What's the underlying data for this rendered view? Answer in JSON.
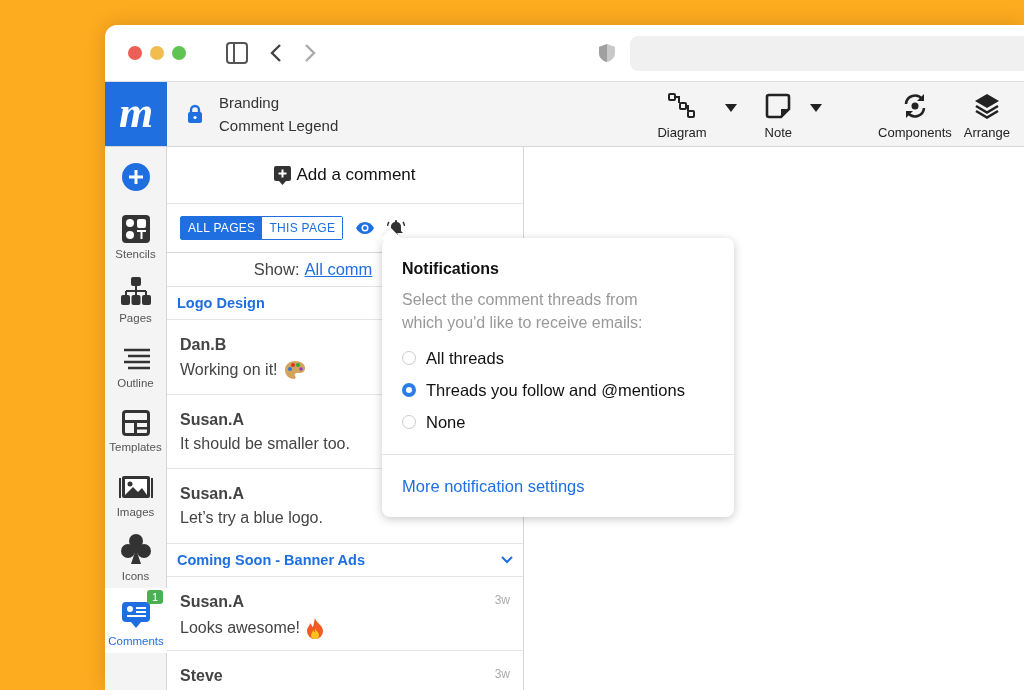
{
  "app": {
    "logo": "m",
    "project": "Branding",
    "document": "Comment Legend"
  },
  "toolbar": [
    {
      "label": "Diagram",
      "has_menu": true
    },
    {
      "label": "Note",
      "has_menu": true
    },
    {
      "label": "Components",
      "has_menu": false
    },
    {
      "label": "Arrange",
      "has_menu": false
    }
  ],
  "rail": [
    {
      "label": "Stencils",
      "selected": false
    },
    {
      "label": "Pages",
      "selected": false
    },
    {
      "label": "Outline",
      "selected": false
    },
    {
      "label": "Templates",
      "selected": false
    },
    {
      "label": "Images",
      "selected": false
    },
    {
      "label": "Icons",
      "selected": false
    },
    {
      "label": "Comments",
      "selected": true,
      "badge": "1"
    }
  ],
  "comments_panel": {
    "add_button": "Add a comment",
    "scope_tabs": [
      {
        "label": "ALL PAGES",
        "selected": true
      },
      {
        "label": "THIS PAGE",
        "selected": false
      }
    ],
    "filter_label": "Show:",
    "filter_link": "All comm",
    "groups": [
      {
        "title": "Logo Design",
        "comments": [
          {
            "author": "Dan.B",
            "text": "Working on it!",
            "kind": "palette"
          },
          {
            "author": "Susan.A",
            "text": "It should be smaller too.",
            "kind": "plain"
          },
          {
            "author": "Susan.A",
            "text": "Let’s try a blue logo.",
            "kind": "plain"
          }
        ]
      },
      {
        "title": "Coming Soon - Banner Ads",
        "has_toggle": true,
        "comments": [
          {
            "author": "Susan.A",
            "text": "Looks awesome!",
            "time": "3w",
            "kind": "fire"
          },
          {
            "author": "Steve",
            "time": "3w"
          }
        ]
      }
    ]
  },
  "notifications": {
    "title": "Notifications",
    "description": "Select the comment threads from which you'd like to receive emails:",
    "options": [
      {
        "label": "All threads",
        "selected": false
      },
      {
        "label": "Threads you follow and @mentions",
        "selected": true
      },
      {
        "label": "None",
        "selected": false
      }
    ],
    "link": "More notification settings"
  }
}
